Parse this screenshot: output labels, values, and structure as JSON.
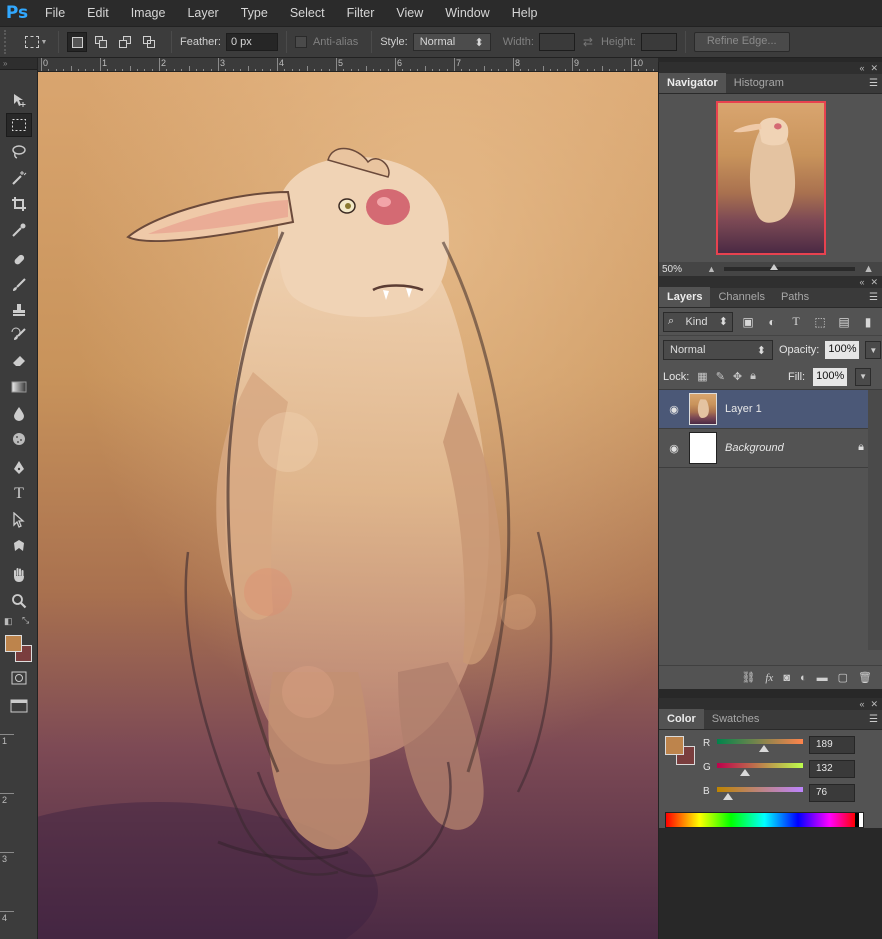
{
  "app": {
    "logo": "Ps"
  },
  "menu": [
    "File",
    "Edit",
    "Image",
    "Layer",
    "Type",
    "Select",
    "Filter",
    "View",
    "Window",
    "Help"
  ],
  "options": {
    "feather_label": "Feather:",
    "feather_value": "0 px",
    "antialias_label": "Anti-alias",
    "style_label": "Style:",
    "style_value": "Normal",
    "width_label": "Width:",
    "height_label": "Height:",
    "refine_edge": "Refine Edge..."
  },
  "ruler": {
    "top": [
      "0",
      "1",
      "2",
      "3",
      "4",
      "5",
      "6",
      "7",
      "8",
      "9",
      "10"
    ],
    "left": [
      "1",
      "2",
      "3",
      "4"
    ]
  },
  "navigator": {
    "tabs": [
      "Navigator",
      "Histogram"
    ],
    "zoom": "50%"
  },
  "layers": {
    "tabs": [
      "Layers",
      "Channels",
      "Paths"
    ],
    "filter_kind": "Kind",
    "blend_mode": "Normal",
    "opacity_label": "Opacity:",
    "opacity_value": "100%",
    "lock_label": "Lock:",
    "fill_label": "Fill:",
    "fill_value": "100%",
    "items": [
      {
        "name": "Layer 1",
        "selected": true
      },
      {
        "name": "Background",
        "selected": false,
        "locked": true
      }
    ]
  },
  "color": {
    "tabs": [
      "Color",
      "Swatches"
    ],
    "r_label": "R",
    "r_value": "189",
    "g_label": "G",
    "g_value": "132",
    "b_label": "B",
    "b_value": "76",
    "foreground": "#bd844c",
    "background": "#7a3e3e"
  }
}
